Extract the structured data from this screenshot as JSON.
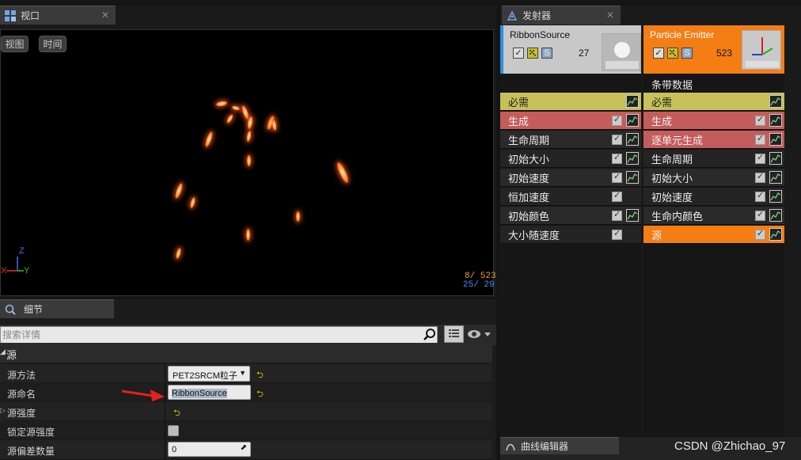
{
  "viewport": {
    "tab_title": "视口",
    "close": "✕",
    "buttons": [
      "视图",
      "时间"
    ],
    "stats": {
      "line1": "8/ 523",
      "line2": "25/  29"
    },
    "axes": {
      "x": "X",
      "y": "Y",
      "z": "Z"
    }
  },
  "details": {
    "tab_title": "细节",
    "search_placeholder": "搜索详情",
    "category": "源",
    "rows": [
      {
        "label": "源方法",
        "value": "PET2SRCM粒子"
      },
      {
        "label": "源命名",
        "value": "RibbonSource"
      },
      {
        "label": "源强度",
        "value": ""
      },
      {
        "label": "锁定源强度",
        "value": ""
      },
      {
        "label": "源偏差数量",
        "value": "0"
      }
    ]
  },
  "emitters": {
    "tab_title": "发射器",
    "close": "✕",
    "left": {
      "name": "RibbonSource",
      "count": "27",
      "s_label": "S",
      "modules": [
        "必需",
        "生成",
        "生命周期",
        "初始大小",
        "初始速度",
        "恒加速度",
        "初始颜色",
        "大小随速度"
      ]
    },
    "right": {
      "name": "Particle Emitter",
      "count": "523",
      "s_label": "S",
      "type_label": "条带数据",
      "modules": [
        "必需",
        "生成",
        "逐单元生成",
        "生命周期",
        "初始大小",
        "初始速度",
        "生命内颜色",
        "源"
      ]
    },
    "colors": {
      "required": "#c6c15a",
      "spawn": "#c45c5c",
      "selected": "#f47d14",
      "left_accent": "#2a8fe0"
    }
  },
  "curve_editor": {
    "tab_title": "曲线编辑器"
  },
  "watermark": "CSDN @Zhichao_97"
}
